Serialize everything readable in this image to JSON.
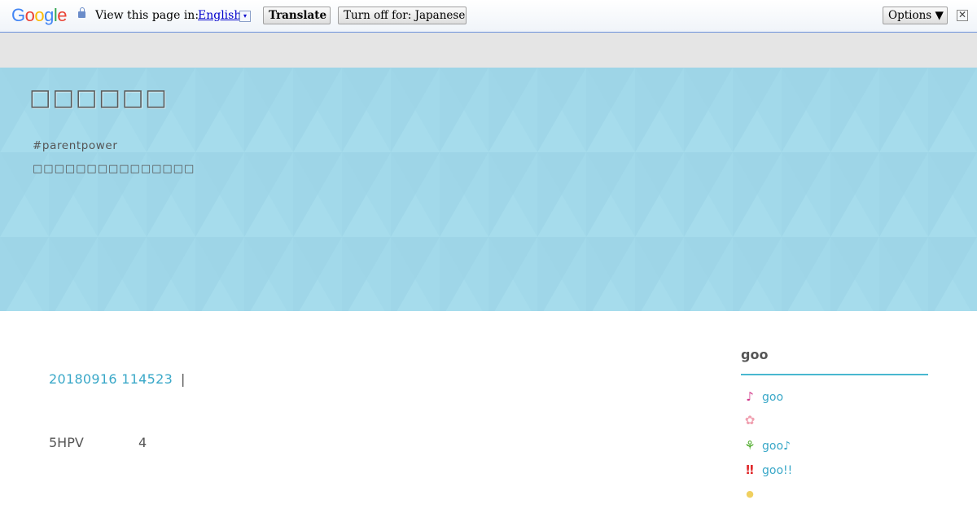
{
  "translate_bar": {
    "logo": "Google",
    "label": "View this page in:",
    "language": "English",
    "language_arrow": "▾",
    "translate_button": "Translate",
    "turn_off_button": "Turn off for: Japanese",
    "options_button": "Options ▼",
    "close_icon": "✕"
  },
  "header": {
    "site_title": "□□□□□□",
    "tagline": "#parentpower",
    "subtitle": "□□□□□□□□□□□□□□□"
  },
  "post": {
    "date": "20180916 114523",
    "separator": "|",
    "body_text": "5HPV",
    "body_number": "4"
  },
  "sidebar": {
    "title": "goo",
    "items": [
      {
        "icon": "music-note-icon",
        "glyph": "♪",
        "color": "#d23c8c",
        "label": "goo"
      },
      {
        "icon": "flower-icon",
        "glyph": "✿",
        "color": "#f0a0b0",
        "label": ""
      },
      {
        "icon": "sprout-icon",
        "glyph": "⚘",
        "color": "#4caa28",
        "label": "goo♪"
      },
      {
        "icon": "double-exclamation-icon",
        "glyph": "‼",
        "color": "#e0282a",
        "label": "goo!!"
      },
      {
        "icon": "lightbulb-icon",
        "glyph": "●",
        "color": "#f0d060",
        "label": ""
      }
    ]
  },
  "colors": {
    "banner": "#a2d9ea",
    "accent": "#3aa8c8"
  }
}
